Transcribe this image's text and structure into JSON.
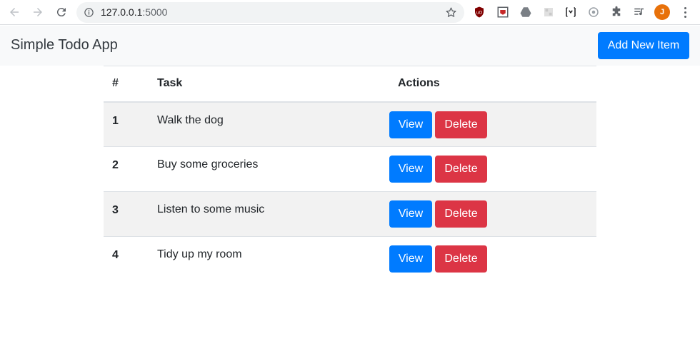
{
  "browser": {
    "url_host": "127.0.0.1",
    "url_port": ":5000",
    "profile_initial": "J",
    "icons": [
      "back-icon",
      "forward-icon",
      "reload-icon",
      "info-icon",
      "star-icon",
      "ublock-extension-icon",
      "extension-icon",
      "drive-extension-icon",
      "extension-icon",
      "extension-icon",
      "extension-icon",
      "puzzle-extensions-icon",
      "media-queue-icon",
      "menu-icon"
    ]
  },
  "navbar": {
    "brand": "Simple Todo App",
    "add_button_label": "Add New Item"
  },
  "table": {
    "headers": {
      "num": "#",
      "task": "Task",
      "actions": "Actions"
    },
    "rows": [
      {
        "num": "1",
        "task": "Walk the dog",
        "view_label": "View",
        "delete_label": "Delete"
      },
      {
        "num": "2",
        "task": "Buy some groceries",
        "view_label": "View",
        "delete_label": "Delete"
      },
      {
        "num": "3",
        "task": "Listen to some music",
        "view_label": "View",
        "delete_label": "Delete"
      },
      {
        "num": "4",
        "task": "Tidy up my room",
        "view_label": "View",
        "delete_label": "Delete"
      }
    ]
  },
  "colors": {
    "primary": "#007bff",
    "danger": "#dc3545",
    "navbar_bg": "#f8f9fa",
    "stripe": "#f2f2f2",
    "avatar": "#e8710a"
  }
}
